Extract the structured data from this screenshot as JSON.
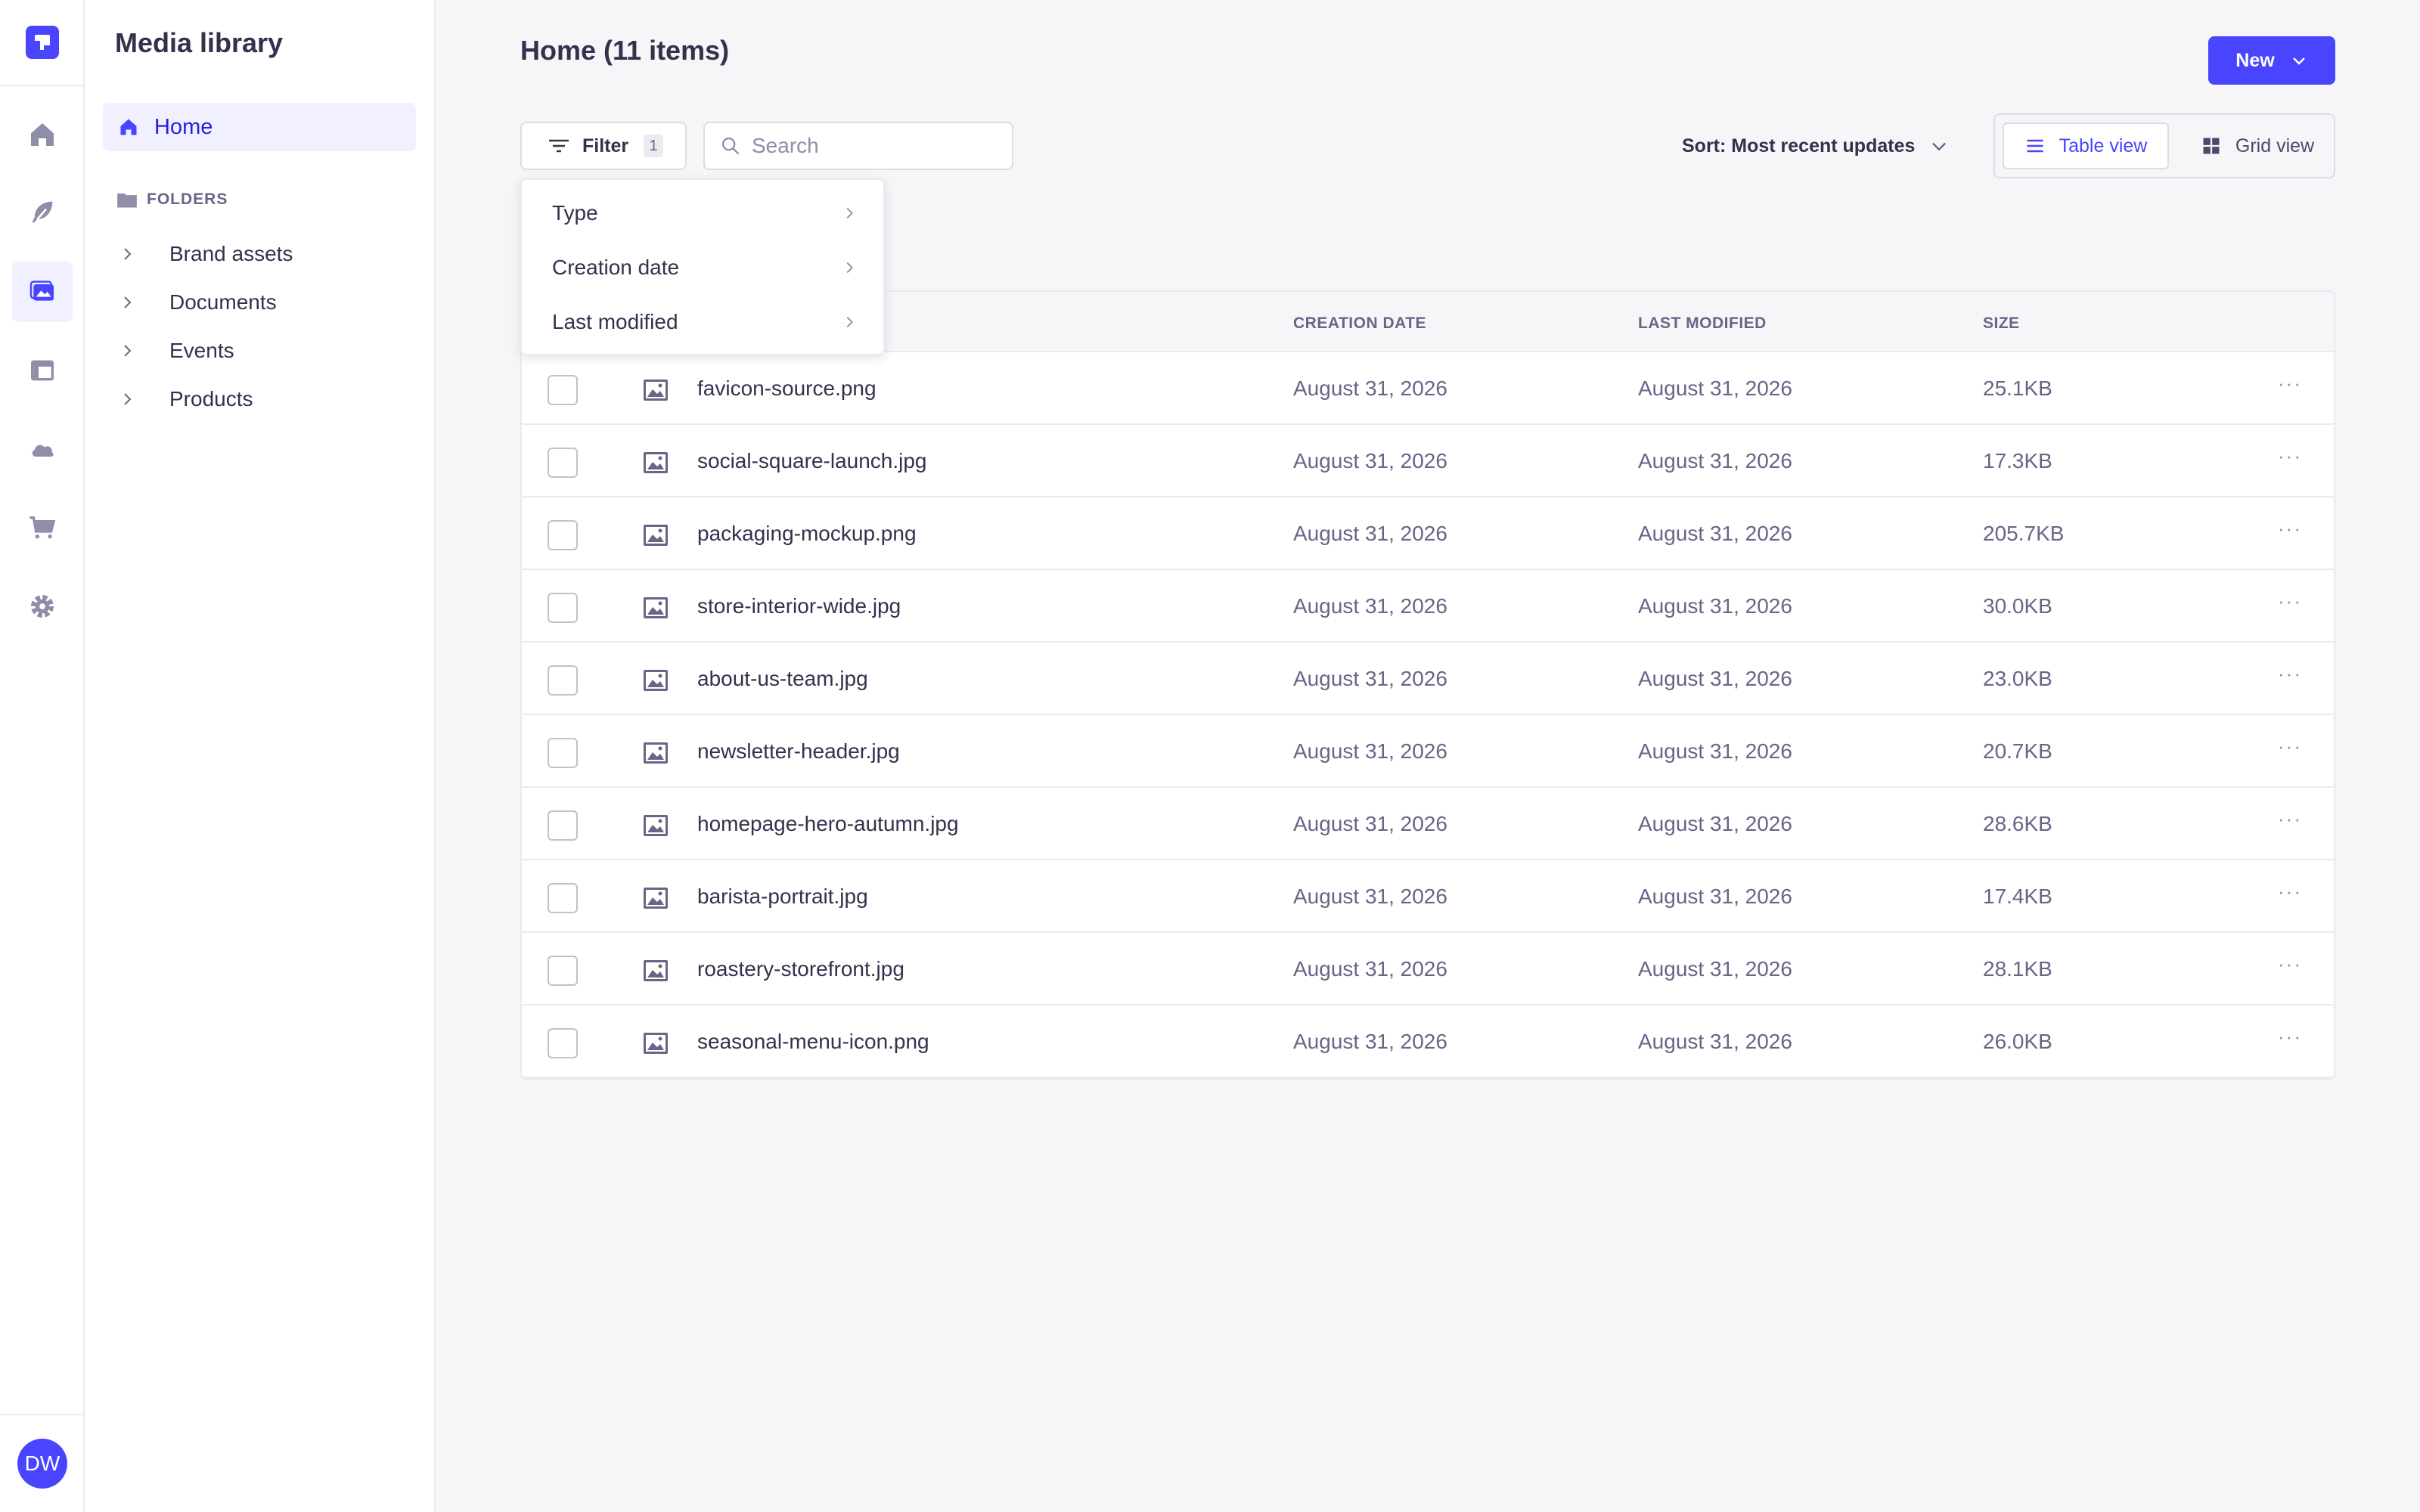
{
  "rail": {
    "avatar_initials": "DW",
    "items": [
      "home-icon",
      "feather-icon",
      "media-icon",
      "layout-icon",
      "cloud-icon",
      "cart-icon",
      "settings-icon"
    ]
  },
  "sidebar": {
    "title": "Media library",
    "home_label": "Home",
    "folders_title": "FOLDERS",
    "folders": [
      "Brand assets",
      "Documents",
      "Events",
      "Products"
    ]
  },
  "main": {
    "title": "Home (11 items)",
    "new_button": "New",
    "filter_label": "Filter",
    "filter_count": "1",
    "search_placeholder": "Search",
    "sort_label": "Sort: Most recent updates",
    "view_table": "Table view",
    "view_grid": "Grid view"
  },
  "filter_menu": {
    "items": [
      "Type",
      "Creation date",
      "Last modified"
    ]
  },
  "table": {
    "headers": {
      "creation_date": "CREATION DATE",
      "last_modified": "LAST MODIFIED",
      "size": "SIZE"
    },
    "more_label": "···",
    "rows": [
      {
        "name": "favicon-source.png",
        "created": "August 31, 2026",
        "modified": "August 31, 2026",
        "size": "25.1KB"
      },
      {
        "name": "social-square-launch.jpg",
        "created": "August 31, 2026",
        "modified": "August 31, 2026",
        "size": "17.3KB"
      },
      {
        "name": "packaging-mockup.png",
        "created": "August 31, 2026",
        "modified": "August 31, 2026",
        "size": "205.7KB"
      },
      {
        "name": "store-interior-wide.jpg",
        "created": "August 31, 2026",
        "modified": "August 31, 2026",
        "size": "30.0KB"
      },
      {
        "name": "about-us-team.jpg",
        "created": "August 31, 2026",
        "modified": "August 31, 2026",
        "size": "23.0KB"
      },
      {
        "name": "newsletter-header.jpg",
        "created": "August 31, 2026",
        "modified": "August 31, 2026",
        "size": "20.7KB"
      },
      {
        "name": "homepage-hero-autumn.jpg",
        "created": "August 31, 2026",
        "modified": "August 31, 2026",
        "size": "28.6KB"
      },
      {
        "name": "barista-portrait.jpg",
        "created": "August 31, 2026",
        "modified": "August 31, 2026",
        "size": "17.4KB"
      },
      {
        "name": "roastery-storefront.jpg",
        "created": "August 31, 2026",
        "modified": "August 31, 2026",
        "size": "28.1KB"
      },
      {
        "name": "seasonal-menu-icon.png",
        "created": "August 31, 2026",
        "modified": "August 31, 2026",
        "size": "26.0KB"
      }
    ]
  },
  "colors": {
    "accent": "#4945ff",
    "accent_light": "#f0f0ff",
    "text": "#32324d",
    "muted": "#666687"
  }
}
